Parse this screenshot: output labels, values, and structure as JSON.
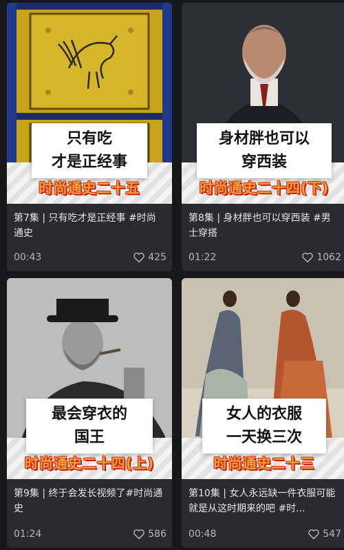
{
  "cards": [
    {
      "caption_line1": "只有吃",
      "caption_line2": "才是正经事",
      "series_label": "时尚通史二十五",
      "title": "第7集 | 只有吃才是正经事 #时尚通史",
      "duration": "00:43",
      "likes": "425",
      "thumb": "peacock-tile-pattern"
    },
    {
      "caption_line1": "身材胖也可以",
      "caption_line2": "穿西装",
      "series_label": "时尚通史二十四(下)",
      "title": "第8集 | 身材胖也可以穿西装 #男士穿搭",
      "duration": "01:22",
      "likes": "1062",
      "thumb": "bearded-man-portrait"
    },
    {
      "caption_line1": "最会穿衣的",
      "caption_line2": "国王",
      "series_label": "时尚通史二十四(上)",
      "title": "第9集 | 终于会发长视频了#时尚通史",
      "duration": "01:24",
      "likes": "586",
      "thumb": "king-with-hat-photo"
    },
    {
      "caption_line1": "女人的衣服",
      "caption_line2": "一天换三次",
      "series_label": "时尚通史二十三",
      "title": "第10集 | 女人永远缺一件衣服可能就是从这时期来的吧 #时...",
      "duration": "00:48",
      "likes": "547",
      "thumb": "victorian-dresses-illustration"
    }
  ],
  "colors": {
    "background": "#17181c",
    "card": "#2a2b31",
    "series_text": "#f2a23a",
    "series_outline": "#d7260f"
  },
  "icons": {
    "like": "heart-outline-icon"
  }
}
